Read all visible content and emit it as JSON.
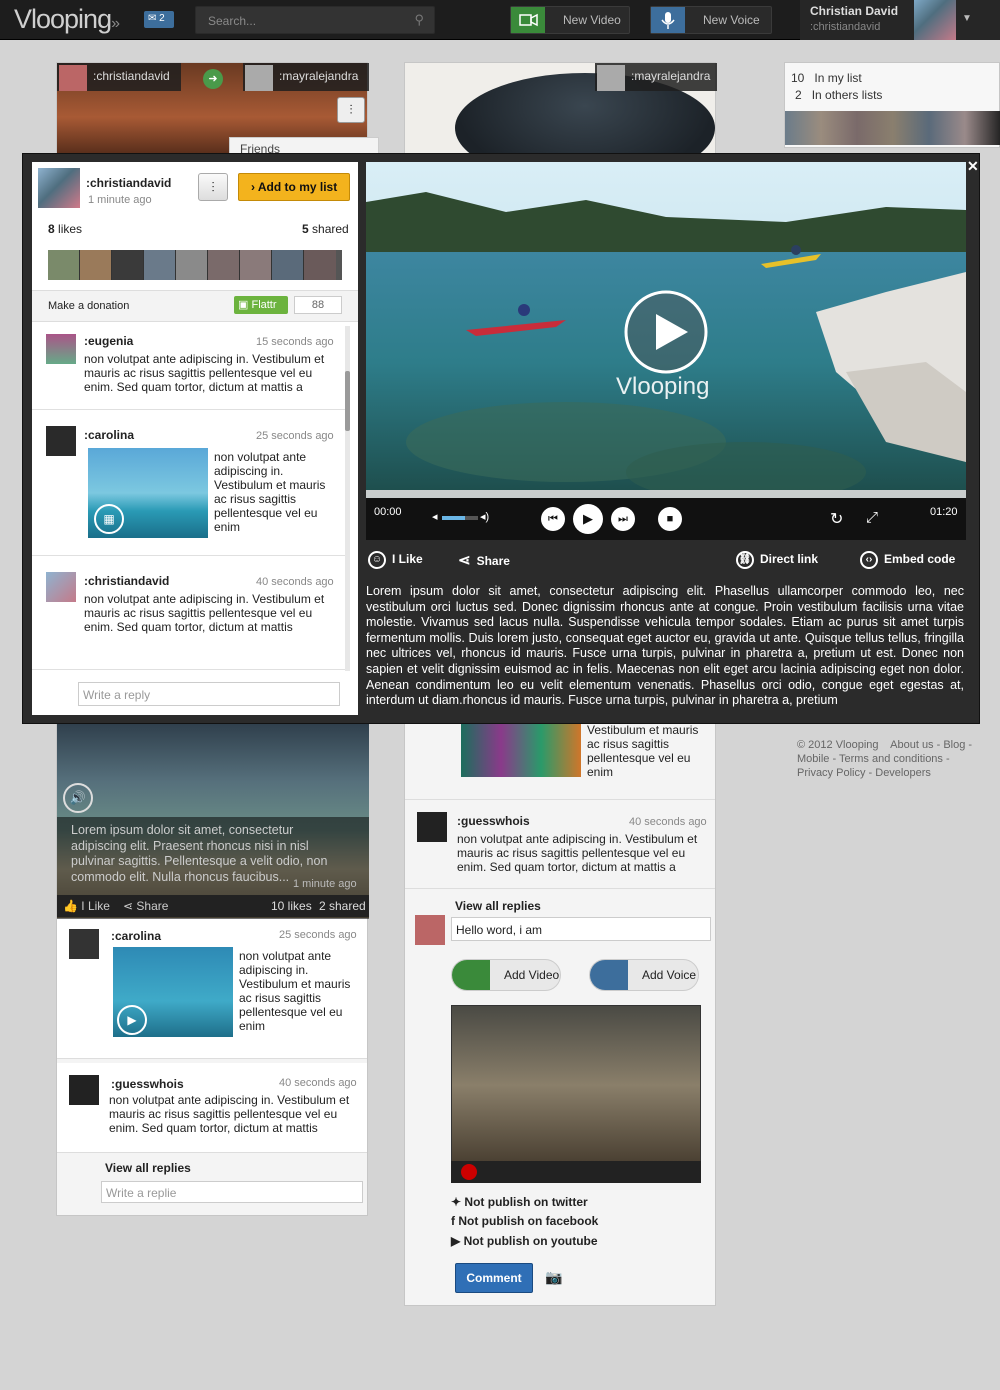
{
  "header": {
    "logo": "Vlooping",
    "messages_count": "2",
    "search_placeholder": "Search...",
    "new_video": "New Video",
    "new_voice": "New Voice",
    "user_name": "Christian David",
    "user_handle": ":christiandavid"
  },
  "background": {
    "card1": {
      "user1": ":christiandavid",
      "user2": ":mayralejandra",
      "menu_item": "Friends"
    },
    "card2": {
      "user": ":mayralejandra"
    },
    "lists": {
      "my_count": "10",
      "my_label": "In my list",
      "others_count": "2",
      "others_label": "In others lists"
    },
    "left_feed": {
      "caption": "Lorem ipsum dolor sit amet, consectetur adipiscing elit. Praesent rhoncus nisi in nisl pulvinar sagittis. Pellentesque a velit odio, non commodo elit. Nulla rhoncus faucibus...",
      "time": "1 minute ago",
      "like": "I Like",
      "share": "Share",
      "likes": "10 likes",
      "shared": "2 shared",
      "comments": [
        {
          "user": ":carolina",
          "time": "25 seconds ago",
          "text": "non volutpat ante adipiscing in. Vestibulum et mauris ac risus sagittis pellentesque vel eu enim"
        },
        {
          "user": ":guesswhois",
          "time": "40 seconds ago",
          "text": "non volutpat ante adipiscing in. Vestibulum et mauris ac risus sagittis pellentesque vel eu enim. Sed quam tortor, dictum at mattis"
        }
      ],
      "view_all": "View all replies",
      "write_placeholder": "Write a replie"
    },
    "mid_feed": {
      "partial_text": "Vestibulum et mauris ac risus sagittis pellentesque vel eu enim",
      "comment": {
        "user": ":guesswhois",
        "time": "40 seconds ago",
        "text": "non volutpat ante adipiscing in. Vestibulum et mauris ac risus sagittis pellentesque vel eu enim. Sed quam tortor, dictum at mattis a"
      },
      "view_all": "View all replies",
      "reply_value": "Hello word, i am",
      "add_video": "Add Video",
      "add_voice": "Add Voice",
      "twitter": "Not publish on twitter",
      "facebook": "Not publish on facebook",
      "youtube": "Not publish on youtube",
      "comment_btn": "Comment"
    },
    "footer": {
      "copyright": "© 2012 Vlooping",
      "about": "About us",
      "blog": "Blog",
      "mobile": "Mobile",
      "terms": "Terms and conditions",
      "privacy": "Privacy Policy",
      "developers": "Developers"
    }
  },
  "modal": {
    "author": ":christiandavid",
    "time": "1 minute ago",
    "add_to_list": "Add to my list",
    "likes_num": "8",
    "likes_label": "likes",
    "shared_num": "5",
    "shared_label": "shared",
    "donation": "Make a donation",
    "flattr": "Flattr",
    "flattr_count": "88",
    "comments": [
      {
        "user": ":eugenia",
        "time": "15 seconds ago",
        "text": "non volutpat ante adipiscing in. Vestibulum et mauris ac risus sagittis pellentesque vel eu enim. Sed quam tortor, dictum at mattis a"
      },
      {
        "user": ":carolina",
        "time": "25 seconds ago",
        "text": "non volutpat ante adipiscing in. Vestibulum et mauris ac risus sagittis pellentesque vel eu enim"
      },
      {
        "user": ":christiandavid",
        "time": "40 seconds ago",
        "text": "non volutpat ante adipiscing in. Vestibulum et mauris ac risus sagittis pellentesque vel eu enim. Sed quam tortor, dictum at mattis"
      }
    ],
    "reply_placeholder": "Write a reply",
    "video": {
      "watermark": "Vlooping",
      "time_current": "00:00",
      "time_total": "01:20",
      "volume_fraction": 0.65
    },
    "actions": {
      "like": "I Like",
      "share": "Share",
      "direct_link": "Direct link",
      "embed": "Embed code"
    },
    "description": "Lorem ipsum dolor sit amet, consectetur adipiscing elit. Phasellus ullamcorper commodo leo, nec vestibulum orci luctus sed. Donec dignissim rhoncus ante at congue. Proin vestibulum facilisis urna vitae molestie. Vivamus sed lacus nulla. Suspendisse vehicula tempor sodales. Etiam ac purus sit amet turpis fermentum mollis. Duis lorem justo, consequat eget auctor eu, gravida ut ante. Quisque tellus tellus, fringilla nec ultrices vel, rhoncus id mauris. Fusce urna turpis, pulvinar in pharetra a, pretium ut est. Donec non sapien et velit dignissim euismod ac in felis. Maecenas non elit eget arcu lacinia adipiscing eget non dolor. Aenean condimentum leo eu velit elementum venenatis. Phasellus orci odio, congue eget egestas at, interdum ut diam.rhoncus id mauris. Fusce urna turpis, pulvinar in pharetra a, pretium"
  }
}
